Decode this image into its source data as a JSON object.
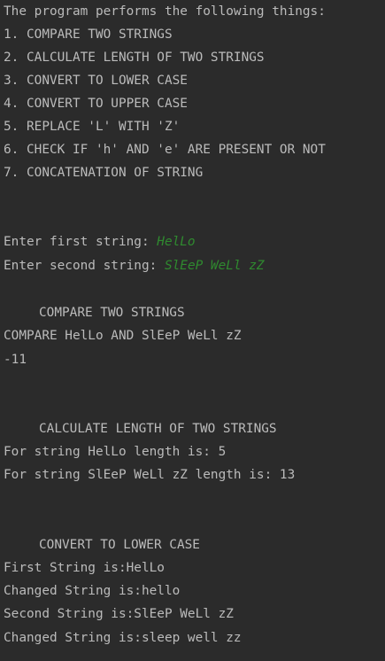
{
  "intro": {
    "header": "The program performs the following things:",
    "items": [
      "1. COMPARE TWO STRINGS",
      "2. CALCULATE LENGTH OF TWO STRINGS",
      "3. CONVERT TO LOWER CASE",
      "4. CONVERT TO UPPER CASE",
      "5. REPLACE 'L' WITH 'Z'",
      "6. CHECK IF 'h' AND 'e' ARE PRESENT OR NOT",
      "7. CONCATENATION OF STRING"
    ]
  },
  "prompts": {
    "first_label": "Enter first string: ",
    "first_value": "HelLo",
    "second_label": "Enter second string: ",
    "second_value": "SlEeP WeLl zZ"
  },
  "compare": {
    "heading": "COMPARE TWO STRINGS",
    "line1": "COMPARE HelLo AND SlEeP WeLl zZ",
    "result": "-11"
  },
  "length": {
    "heading": "CALCULATE LENGTH OF TWO STRINGS",
    "line1": "For string HelLo length is: 5",
    "line2": "For string SlEeP WeLl zZ length is: 13"
  },
  "lower": {
    "heading": "CONVERT TO LOWER CASE",
    "line1": "First String is:HelLo",
    "line2": "Changed String is:hello",
    "line3": "Second String is:SlEeP WeLl zZ",
    "line4": "Changed String is:sleep well zz"
  },
  "colors": {
    "background": "#2b2b2b",
    "text": "#bbbbbb",
    "user_input": "#2f8a2f"
  }
}
